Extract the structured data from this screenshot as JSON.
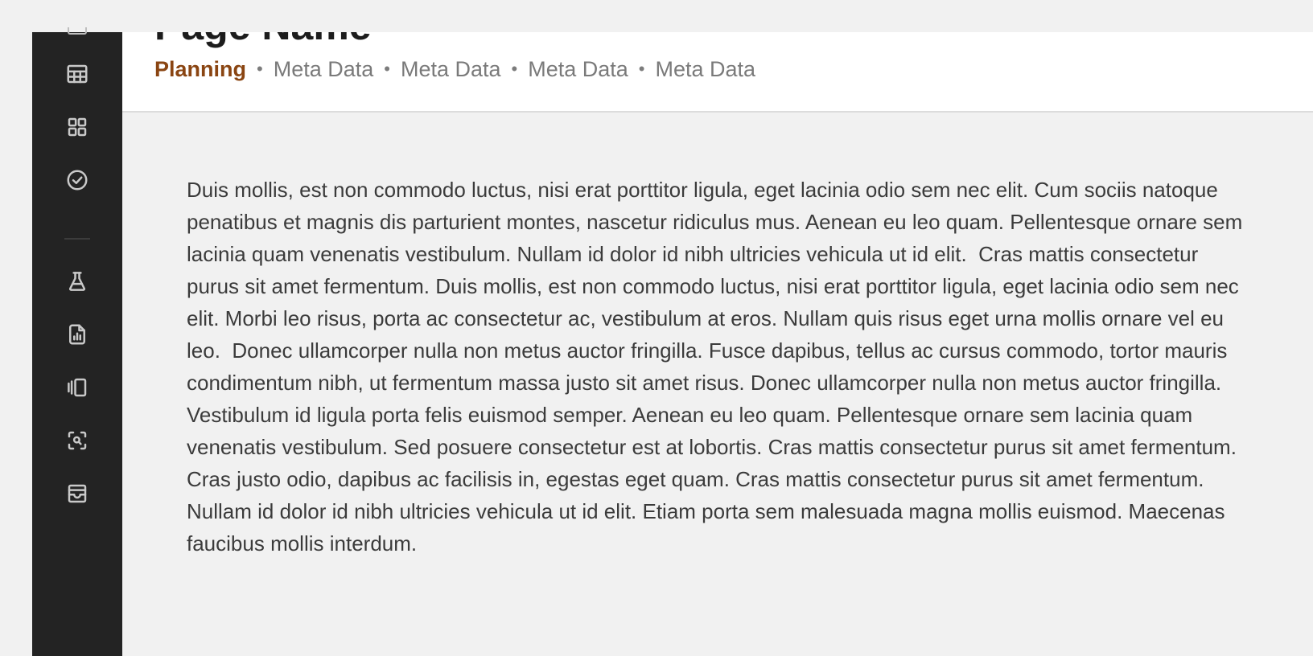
{
  "nav": {
    "items": [
      {
        "icon": "table-icon",
        "name": "table"
      },
      {
        "icon": "grid-icon",
        "name": "grid"
      },
      {
        "icon": "check-circle-icon",
        "name": "tasks"
      },
      {
        "icon": "flask-icon",
        "name": "experiments"
      },
      {
        "icon": "report-chart-icon",
        "name": "reports"
      },
      {
        "icon": "carousel-icon",
        "name": "carousel"
      },
      {
        "icon": "scan-user-icon",
        "name": "scan"
      },
      {
        "icon": "archive-icon",
        "name": "archive"
      }
    ]
  },
  "header": {
    "title": "Page Name",
    "status": "Planning",
    "status_color": "#8a4512",
    "separator": "•",
    "meta": [
      "Meta Data",
      "Meta Data",
      "Meta Data",
      "Meta Data"
    ]
  },
  "content": {
    "paragraph": "Duis mollis, est non commodo luctus, nisi erat porttitor ligula, eget lacinia odio sem nec elit. Cum sociis natoque penatibus et magnis dis parturient montes, nascetur ridiculus mus. Aenean eu leo quam. Pellentesque ornare sem lacinia quam venenatis vestibulum. Nullam id dolor id nibh ultricies vehicula ut id elit.  Cras mattis consectetur purus sit amet fermentum. Duis mollis, est non commodo luctus, nisi erat porttitor ligula, eget lacinia odio sem nec elit. Morbi leo risus, porta ac consectetur ac, vestibulum at eros. Nullam quis risus eget urna mollis ornare vel eu leo.  Donec ullamcorper nulla non metus auctor fringilla. Fusce dapibus, tellus ac cursus commodo, tortor mauris condimentum nibh, ut fermentum massa justo sit amet risus. Donec ullamcorper nulla non metus auctor fringilla. Vestibulum id ligula porta felis euismod semper. Aenean eu leo quam. Pellentesque ornare sem lacinia quam venenatis vestibulum. Sed posuere consectetur est at lobortis. Cras mattis consectetur purus sit amet fermentum.  Cras justo odio, dapibus ac facilisis in, egestas eget quam. Cras mattis consectetur purus sit amet fermentum. Nullam id dolor id nibh ultricies vehicula ut id elit. Etiam porta sem malesuada magna mollis euismod. Maecenas faucibus mollis interdum."
  }
}
